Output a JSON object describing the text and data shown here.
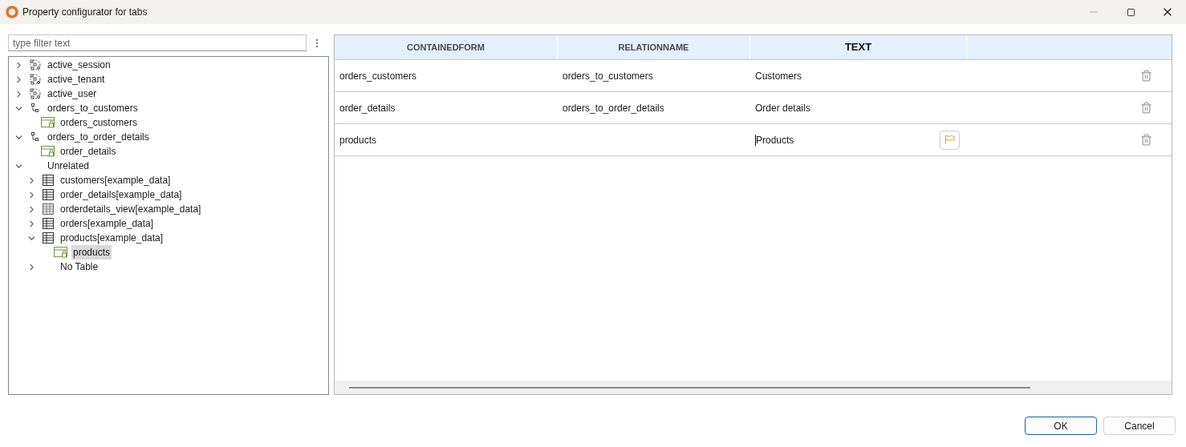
{
  "window": {
    "title": "Property configurator for tabs"
  },
  "filter": {
    "placeholder": "type filter text"
  },
  "tree": [
    {
      "label": "active_session",
      "kind": "relation-group",
      "expanded": false,
      "selected": false
    },
    {
      "label": "active_tenant",
      "kind": "relation-group",
      "expanded": false,
      "selected": false
    },
    {
      "label": "active_user",
      "kind": "relation-group",
      "expanded": false,
      "selected": false
    },
    {
      "label": "orders_to_customers",
      "kind": "relation",
      "expanded": true,
      "selected": false,
      "children": [
        {
          "label": "orders_customers",
          "kind": "form",
          "selected": false
        }
      ]
    },
    {
      "label": "orders_to_order_details",
      "kind": "relation",
      "expanded": true,
      "selected": false,
      "children": [
        {
          "label": "order_details",
          "kind": "form",
          "selected": false
        }
      ]
    },
    {
      "label": "Unrelated",
      "kind": "folder",
      "expanded": true,
      "selected": false,
      "children": [
        {
          "label": "customers[example_data]",
          "kind": "table",
          "expanded": false,
          "selected": false
        },
        {
          "label": "order_details[example_data]",
          "kind": "table",
          "expanded": false,
          "selected": false
        },
        {
          "label": "orderdetails_view[example_data]",
          "kind": "view",
          "expanded": false,
          "selected": false
        },
        {
          "label": "orders[example_data]",
          "kind": "table",
          "expanded": false,
          "selected": false
        },
        {
          "label": "products[example_data]",
          "kind": "table",
          "expanded": true,
          "selected": false,
          "children": [
            {
              "label": "products",
              "kind": "form",
              "selected": true
            }
          ]
        },
        {
          "label": "No Table",
          "kind": "folder",
          "expanded": false,
          "selected": false
        }
      ]
    }
  ],
  "table": {
    "columns": [
      {
        "label": "CONTAINEDFORM",
        "bold": false
      },
      {
        "label": "RELATIONNAME",
        "bold": false
      },
      {
        "label": "TEXT",
        "bold": true
      }
    ],
    "rows": [
      {
        "cells": [
          "orders_customers",
          "orders_to_customers",
          "Customers"
        ],
        "editing": false
      },
      {
        "cells": [
          "order_details",
          "orders_to_order_details",
          "Order details"
        ],
        "editing": false
      },
      {
        "cells": [
          "products",
          "",
          "Products"
        ],
        "editing": true
      }
    ]
  },
  "buttons": [
    {
      "label": "OK",
      "default": true
    },
    {
      "label": "Cancel",
      "default": false
    }
  ]
}
